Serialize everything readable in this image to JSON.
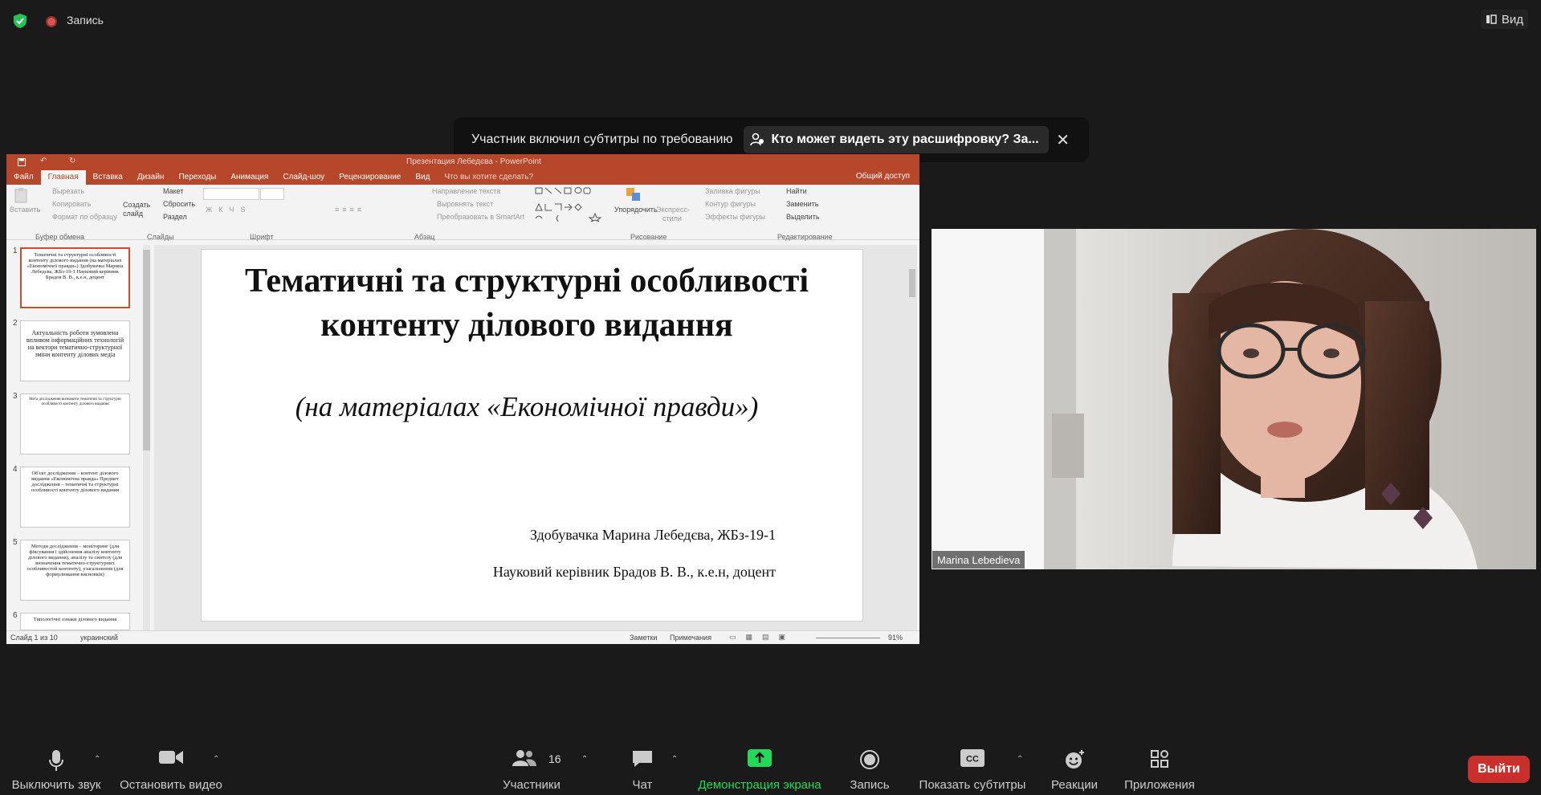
{
  "top": {
    "recording": "Запись",
    "view": "Вид"
  },
  "notification": {
    "message": "Участник включил субтитры по требованию",
    "link": "Кто может видеть эту расшифровку? За..."
  },
  "ppt": {
    "window_title": "Презентация Лебедєва - PowerPoint",
    "tabs": [
      "Файл",
      "Главная",
      "Вставка",
      "Дизайн",
      "Переходы",
      "Анимация",
      "Слайд-шоу",
      "Рецензирование",
      "Вид",
      "Что вы хотите сделать?"
    ],
    "share": "Общий доступ",
    "ribbon": {
      "paste": "Вставить",
      "cut": "Вырезать",
      "copy": "Копировать",
      "format": "Формат по образцу",
      "clipboard": "Буфер обмена",
      "create_slide": "Создать слайд",
      "layout": "Макет",
      "reset": "Сбросить",
      "section": "Раздел",
      "slides": "Слайды",
      "font": "Шрифт",
      "paragraph": "Абзац",
      "text_direction": "Направление текста",
      "align_text": "Выровнять текст",
      "smartart": "Преобразовать в SmartArt",
      "arrange": "Упорядочить",
      "quick_styles": "Экспресс-стили",
      "fill": "Заливка фигуры",
      "outline": "Контур фигуры",
      "effects": "Эффекты фигуры",
      "drawing": "Рисование",
      "find": "Найти",
      "replace": "Заменить",
      "select": "Выделить",
      "editing": "Редактирование"
    },
    "thumbnails": [
      {
        "num": "1",
        "text": "Тематичні та структурні особливості контенту ділового видання (на матеріалах «Економічної правди»)  Здобувачка Марина Лебедєва, ЖБз-19-1 Науковий керівник Брадов В. В., к.е.н, доцент"
      },
      {
        "num": "2",
        "text": "Актуальність роботи зумовлена впливом інформаційних технологій на вектори тематично-структурної зміни контенту ділових медіа"
      },
      {
        "num": "3",
        "text": "Мета дослідження визначити тематичні та структурні особливості контенту ділового видання"
      },
      {
        "num": "4",
        "text": "Об'єкт дослідження – контент ділового видання «Економічна правда» Предмет дослідження – тематичні та структурні особливості контенту ділового видання"
      },
      {
        "num": "5",
        "text": "Методи дослідження – моніторинг (для фіксування і здійснення аналізу контенту ділового видання), аналізу та синтезу (для визначення тематично-структурних особливостей контенту), узагальнення (для формулювання висновків)"
      },
      {
        "num": "6",
        "text": "Типологічні ознаки ділового видання"
      }
    ],
    "slide": {
      "title": "Тематичні та структурні особливості контенту ділового видання",
      "subtitle": "(на матеріалах «Економічної правди»)",
      "author": "Здобувачка Марина Лебедєва, ЖБз-19-1",
      "advisor": "Науковий керівник Брадов В. В., к.е.н, доцент"
    },
    "status": {
      "slide_count": "Слайд 1 из 10",
      "language": "украинский",
      "notes": "Заметки",
      "comments": "Примечания",
      "zoom": "91%"
    }
  },
  "video": {
    "participant": "Marina Lebedieva"
  },
  "toolbar": {
    "mute": "Выключить звук",
    "video": "Остановить видео",
    "participants": "Участники",
    "participants_count": "16",
    "chat": "Чат",
    "share": "Демонстрация экрана",
    "record": "Запись",
    "captions": "Показать субтитры",
    "reactions": "Реакции",
    "apps": "Приложения",
    "exit": "Выйти"
  },
  "colors": {
    "ppt_accent": "#b7472a",
    "share_green": "#23d959",
    "exit_red": "#c9302c"
  }
}
